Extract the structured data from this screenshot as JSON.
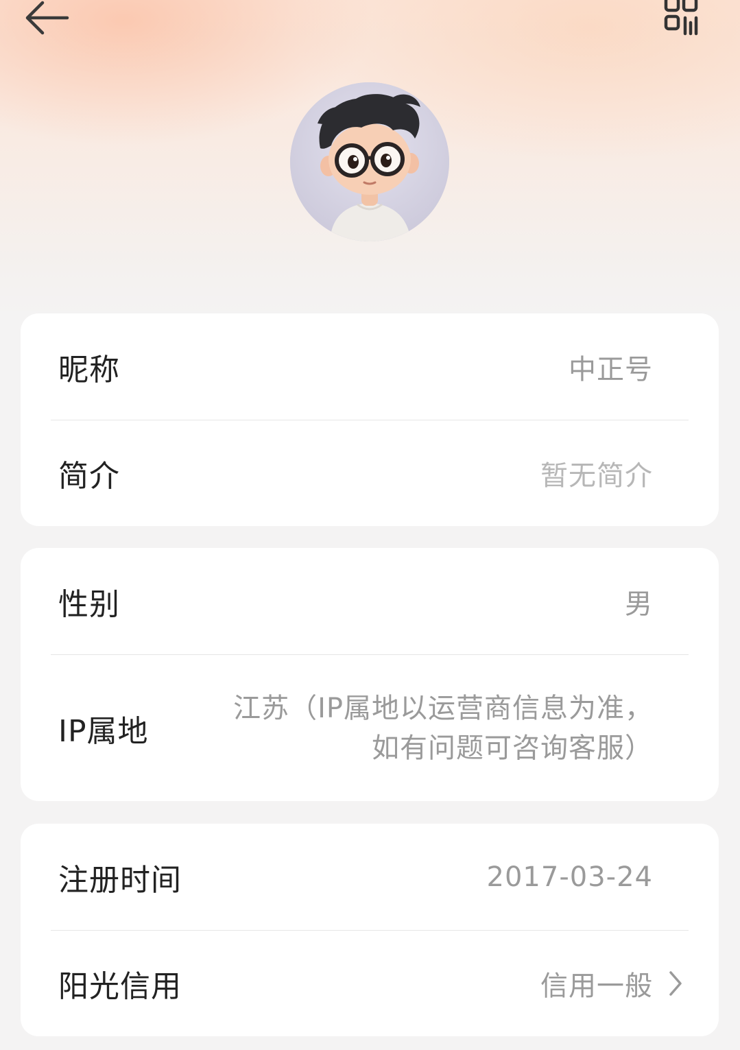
{
  "header": {
    "back_icon": "arrow-left-icon",
    "qr_icon": "qr-code-icon"
  },
  "profile": {
    "avatar": "cartoon-boy-with-glasses-avatar"
  },
  "groups": [
    {
      "rows": [
        {
          "label": "昵称",
          "value": "中正号"
        },
        {
          "label": "简介",
          "value": "暂无简介"
        }
      ]
    },
    {
      "rows": [
        {
          "label": "性别",
          "value": "男"
        },
        {
          "label": "IP属地",
          "value_line1": "江苏（IP属地以运营商信息为准，",
          "value_line2": "如有问题可咨询客服）"
        }
      ]
    },
    {
      "rows": [
        {
          "label": "注册时间",
          "value": "2017-03-24"
        },
        {
          "label": "阳光信用",
          "value": "信用一般",
          "chevron_icon": "chevron-right-icon"
        }
      ]
    }
  ],
  "colors": {
    "label": "#222222",
    "value": "#9a9a9a",
    "placeholder": "#b7b7b7",
    "card_bg": "#ffffff",
    "page_bg": "#f4f3f3"
  }
}
